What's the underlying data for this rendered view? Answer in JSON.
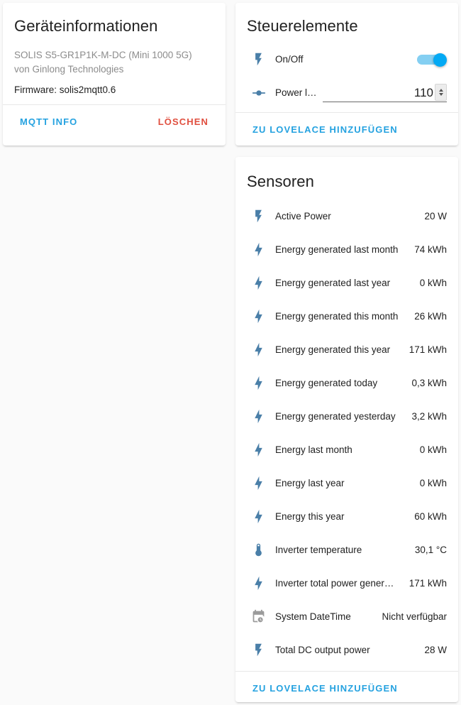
{
  "colors": {
    "accent": "#03a9f4",
    "link": "#25a2e0",
    "danger": "#e04f3f",
    "icon": "#4a7fa8",
    "icon_disabled": "#9b9b9b",
    "text_primary": "#212121",
    "text_secondary": "#8c8c8c",
    "card_bg": "#ffffff",
    "page_bg": "#fafafa"
  },
  "device_info": {
    "title": "Geräteinformationen",
    "model": "SOLIS S5-GR1P1K-M-DC (Mini 1000 5G)",
    "manufacturer": "von Ginlong Technologies",
    "firmware": "Firmware: solis2mqtt0.6",
    "actions": {
      "mqtt_info_label": "MQTT INFO",
      "delete_label": "LÖSCHEN"
    }
  },
  "controls": {
    "title": "Steuerelemente",
    "add_to_lovelace_label": "ZU LOVELACE HINZUFÜGEN",
    "rows": [
      {
        "name": "On/Off",
        "icon": "flash-icon",
        "control": "toggle",
        "toggle_on": true
      },
      {
        "name": "Power li…",
        "icon": "slider-knob-icon",
        "control": "number",
        "value": "110"
      }
    ]
  },
  "sensors": {
    "title": "Sensoren",
    "add_to_lovelace_label": "ZU LOVELACE HINZUFÜGEN",
    "rows": [
      {
        "name": "Active Power",
        "value": "20 W",
        "icon": "flash-icon"
      },
      {
        "name": "Energy generated last month",
        "value": "74 kWh",
        "icon": "lightning-bolt-icon"
      },
      {
        "name": "Energy generated last year",
        "value": "0 kWh",
        "icon": "lightning-bolt-icon"
      },
      {
        "name": "Energy generated this month",
        "value": "26 kWh",
        "icon": "lightning-bolt-icon"
      },
      {
        "name": "Energy generated this year",
        "value": "171 kWh",
        "icon": "lightning-bolt-icon"
      },
      {
        "name": "Energy generated today",
        "value": "0,3 kWh",
        "icon": "lightning-bolt-icon"
      },
      {
        "name": "Energy generated yesterday",
        "value": "3,2 kWh",
        "icon": "lightning-bolt-icon"
      },
      {
        "name": "Energy last month",
        "value": "0 kWh",
        "icon": "lightning-bolt-icon"
      },
      {
        "name": "Energy last year",
        "value": "0 kWh",
        "icon": "lightning-bolt-icon"
      },
      {
        "name": "Energy this year",
        "value": "60 kWh",
        "icon": "lightning-bolt-icon"
      },
      {
        "name": "Inverter temperature",
        "value": "30,1 °C",
        "icon": "thermometer-icon"
      },
      {
        "name": "Inverter total power gener…",
        "value": "171 kWh",
        "icon": "lightning-bolt-icon"
      },
      {
        "name": "System DateTime",
        "value": "Nicht verfügbar",
        "icon": "calendar-clock-icon",
        "unavailable": true
      },
      {
        "name": "Total DC output power",
        "value": "28 W",
        "icon": "flash-icon"
      }
    ]
  }
}
